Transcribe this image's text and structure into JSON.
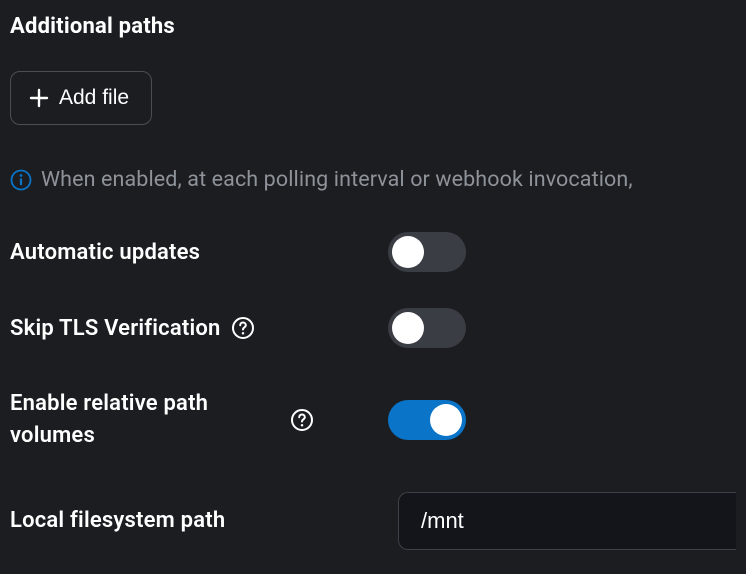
{
  "sectionTitle": "Additional paths",
  "addFileLabel": "Add file",
  "infoText": "When enabled, at each polling interval or webhook invocation,",
  "rows": {
    "autoUpdates": {
      "label": "Automatic updates",
      "on": false,
      "help": false
    },
    "skipTls": {
      "label": "Skip TLS Verification",
      "on": false,
      "help": true
    },
    "relPath": {
      "label": "Enable relative path volumes",
      "on": true,
      "help": true
    }
  },
  "localPath": {
    "label": "Local filesystem path",
    "value": "/mnt"
  }
}
